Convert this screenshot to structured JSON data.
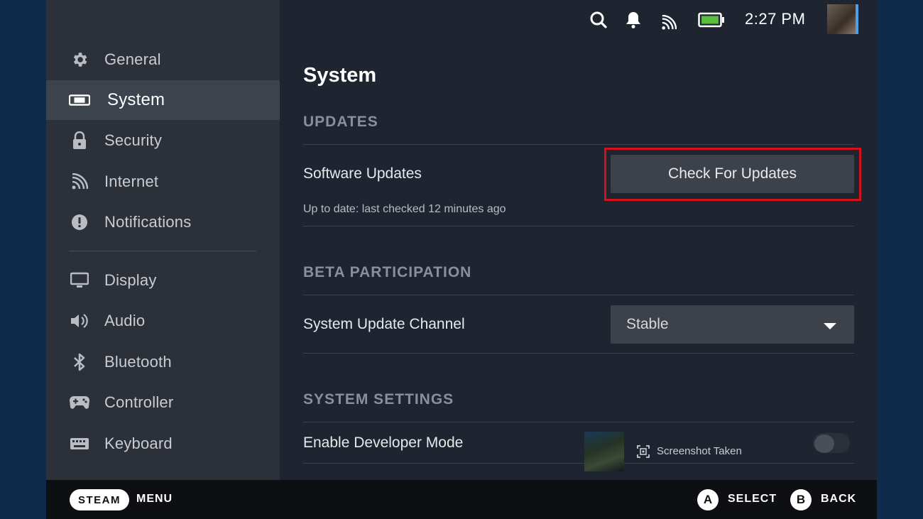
{
  "topbar": {
    "time": "2:27 PM",
    "icons": [
      "search-icon",
      "bell-icon",
      "wifi-icon",
      "battery-icon"
    ]
  },
  "sidebar": {
    "items": [
      {
        "label": "General",
        "icon": "gear-icon"
      },
      {
        "label": "System",
        "icon": "system-icon",
        "active": true
      },
      {
        "label": "Security",
        "icon": "lock-icon"
      },
      {
        "label": "Internet",
        "icon": "wifi-icon"
      },
      {
        "label": "Notifications",
        "icon": "alert-icon"
      },
      {
        "label": "Display",
        "icon": "monitor-icon"
      },
      {
        "label": "Audio",
        "icon": "speaker-icon"
      },
      {
        "label": "Bluetooth",
        "icon": "bluetooth-icon"
      },
      {
        "label": "Controller",
        "icon": "gamepad-icon"
      },
      {
        "label": "Keyboard",
        "icon": "keyboard-icon"
      }
    ]
  },
  "main": {
    "title": "System",
    "updates": {
      "header": "UPDATES",
      "software_label": "Software Updates",
      "status": "Up to date: last checked 12 minutes ago",
      "check_button": "Check For Updates"
    },
    "beta": {
      "header": "BETA PARTICIPATION",
      "channel_label": "System Update Channel",
      "channel_value": "Stable"
    },
    "system_settings": {
      "header": "SYSTEM SETTINGS",
      "dev_mode_label": "Enable Developer Mode",
      "dev_mode_enabled": false
    },
    "toast": {
      "text": "Screenshot Taken"
    }
  },
  "bottombar": {
    "steam": "STEAM",
    "menu": "MENU",
    "a_key": "A",
    "select": "SELECT",
    "b_key": "B",
    "back": "BACK"
  },
  "colors": {
    "highlight_border": "#d4111a",
    "accent": "#4ea0ea"
  }
}
